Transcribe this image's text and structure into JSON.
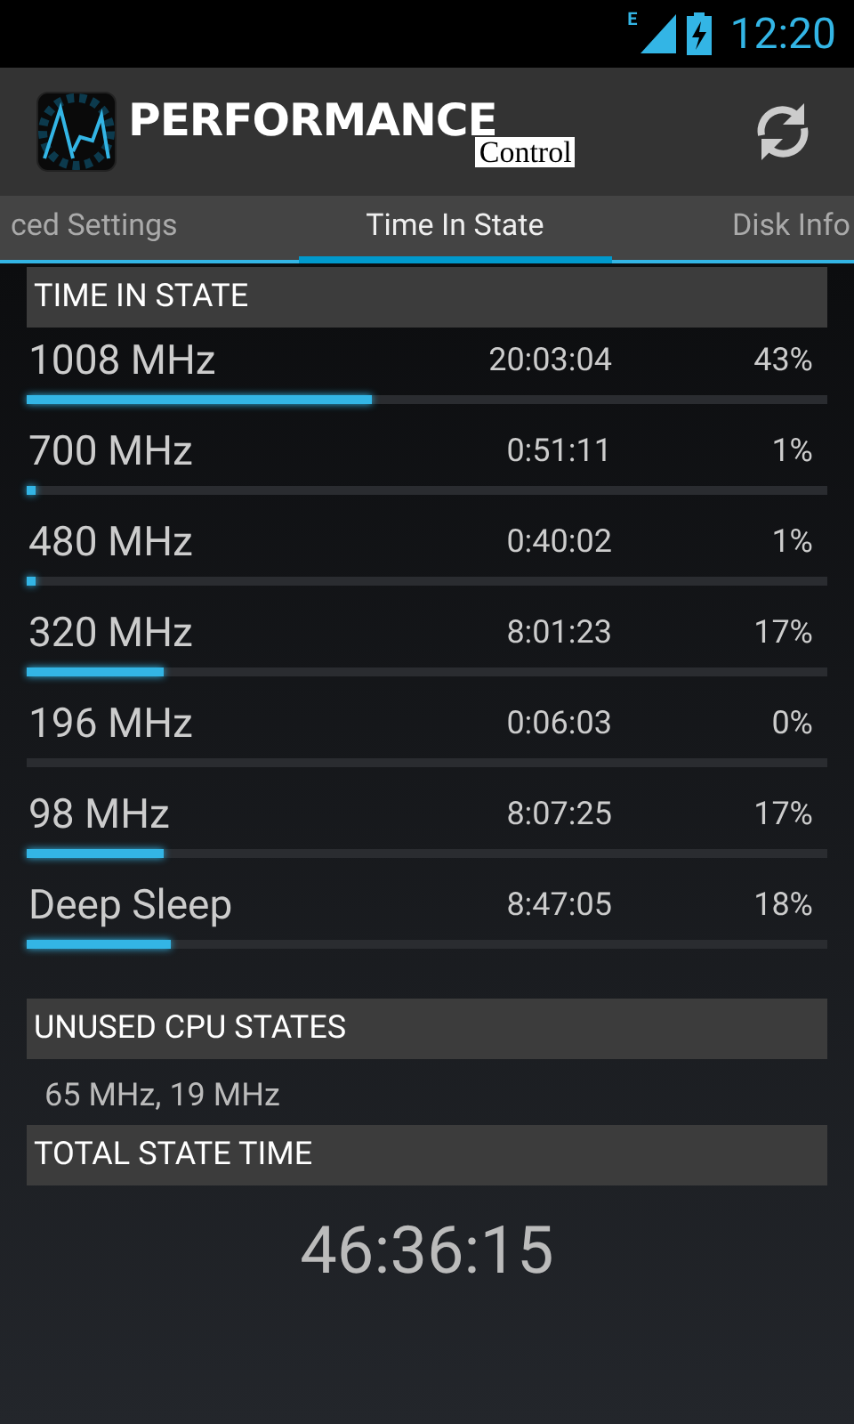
{
  "status_bar": {
    "network": "E",
    "time": "12:20"
  },
  "app_bar": {
    "title": "PERFORMANCE",
    "subtitle": "Control"
  },
  "tabs": [
    {
      "label": "ced Settings",
      "selected": false
    },
    {
      "label": "Time In State",
      "selected": true
    },
    {
      "label": "Disk Info",
      "selected": false
    }
  ],
  "time_in_state": {
    "header": "TIME IN STATE",
    "rows": [
      {
        "frequency": "1008 MHz",
        "time": "20:03:04",
        "percent": "43%",
        "level": 0.43
      },
      {
        "frequency": "700 MHz",
        "time": "0:51:11",
        "percent": "1%",
        "level": 0.01
      },
      {
        "frequency": "480 MHz",
        "time": "0:40:02",
        "percent": "1%",
        "level": 0.01
      },
      {
        "frequency": "320 MHz",
        "time": "8:01:23",
        "percent": "17%",
        "level": 0.17
      },
      {
        "frequency": "196 MHz",
        "time": "0:06:03",
        "percent": "0%"
      },
      {
        "frequency": "98 MHz",
        "time": "8:07:25",
        "percent": "17%",
        "level": 0.17
      },
      {
        "frequency": "Deep Sleep",
        "time": "8:47:05",
        "percent": "18%",
        "level": 0.18
      }
    ]
  },
  "unused_cpu_states": {
    "header": "UNUSED CPU STATES",
    "value": "65 MHz, 19 MHz"
  },
  "total_state_time": {
    "header": "TOTAL STATE TIME",
    "value": "46:36:15"
  }
}
